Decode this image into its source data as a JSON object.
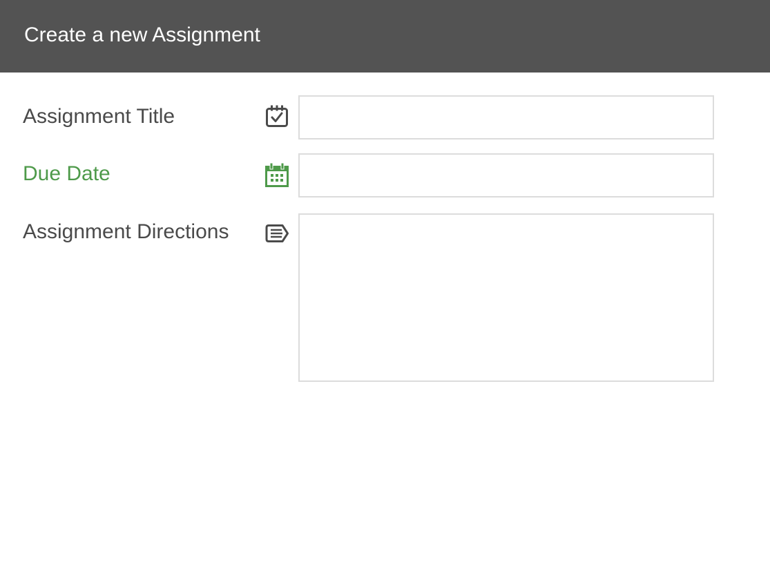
{
  "header": {
    "title": "Create a new Assignment"
  },
  "form": {
    "fields": [
      {
        "label": "Assignment Title",
        "icon": "calendar-check-icon",
        "value": "",
        "placeholder": ""
      },
      {
        "label": "Due Date",
        "icon": "calendar-grid-icon",
        "value": "",
        "placeholder": "",
        "active": true
      },
      {
        "label": "Assignment Directions",
        "icon": "note-lines-icon",
        "value": "",
        "placeholder": ""
      }
    ]
  },
  "colors": {
    "header_bg": "#535353",
    "header_text": "#ffffff",
    "label_text": "#4a4a4a",
    "active_accent": "#4e9a4a",
    "input_border": "#dcdcdc"
  }
}
